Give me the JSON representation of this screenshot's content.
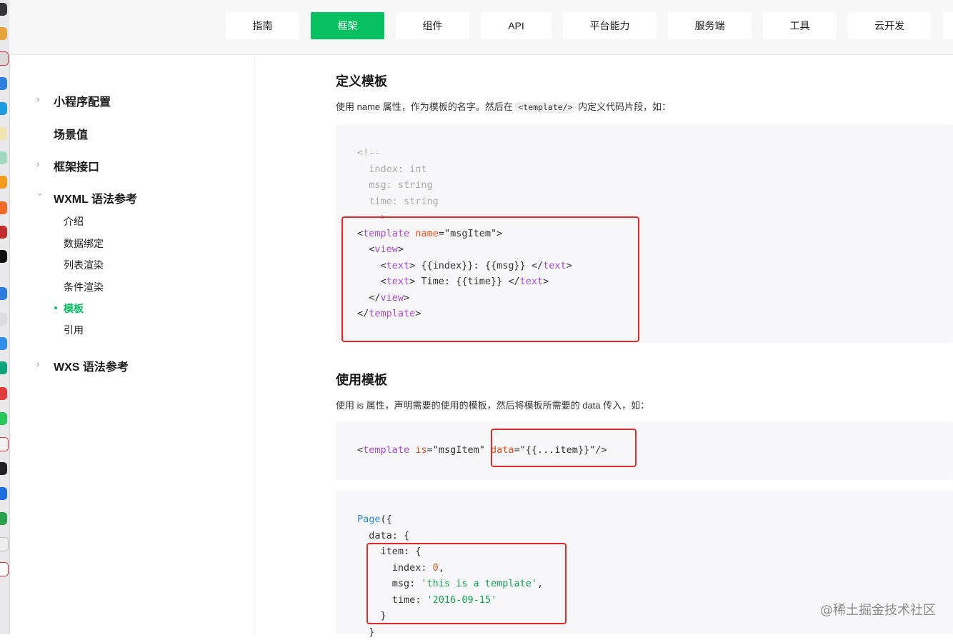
{
  "nav": {
    "tabs": [
      "指南",
      "框架",
      "组件",
      "API",
      "平台能力",
      "服务端",
      "工具",
      "云开发"
    ],
    "active_tab": "框架",
    "accent_color": "#07c160"
  },
  "sidebar": {
    "items": [
      {
        "label": "小程序配置",
        "expandable": true
      },
      {
        "label": "场景值",
        "expandable": false
      },
      {
        "label": "框架接口",
        "expandable": true
      },
      {
        "label": "WXML 语法参考",
        "expandable": true,
        "expanded": true
      },
      {
        "label": "WXS 语法参考",
        "expandable": true
      }
    ],
    "wxml_children": [
      "介绍",
      "数据绑定",
      "列表渲染",
      "条件渲染",
      "模板",
      "引用"
    ],
    "active_child": "模板"
  },
  "content": {
    "section1": {
      "title": "定义模板",
      "desc_before": "使用 name 属性，作为模板的名字。然后在",
      "desc_code": "<template/>",
      "desc_after": "内定义代码片段，如："
    },
    "section2": {
      "title": "使用模板",
      "desc": "使用 is 属性，声明需要的使用的模板，然后将模板所需要的 data 传入，如："
    }
  },
  "watermark": "@稀土掘金技术社区",
  "highlight_color": "#e02a2a"
}
